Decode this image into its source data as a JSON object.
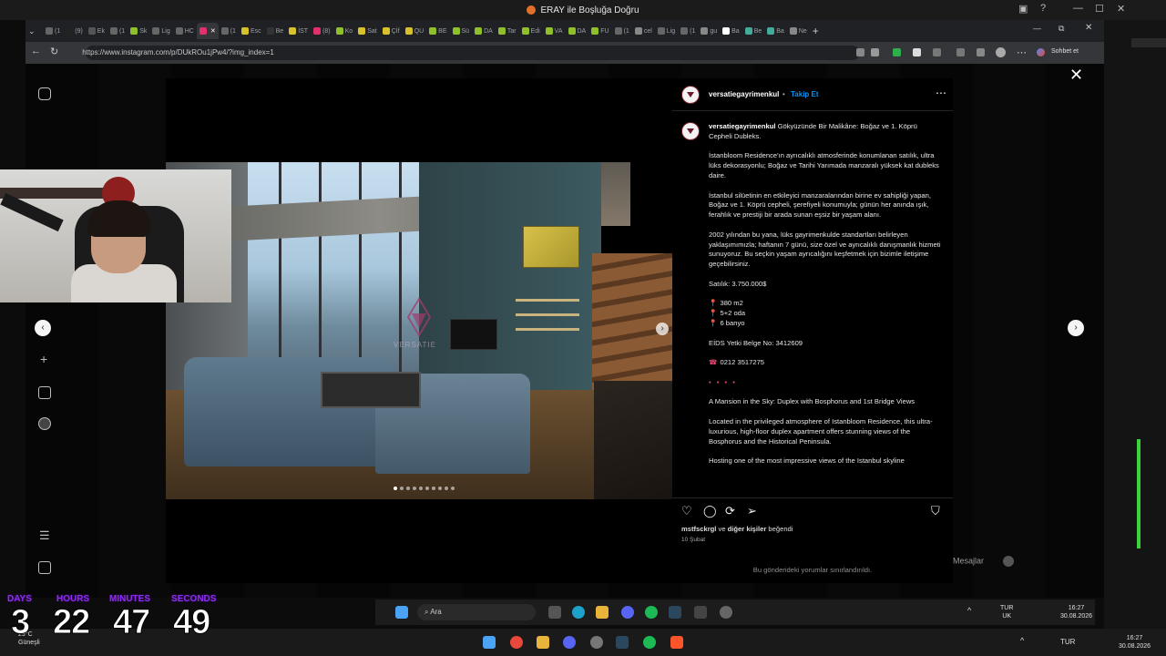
{
  "window": {
    "title": "ERAY ile Boşluğa Doğru"
  },
  "browser": {
    "tabs": [
      {
        "label": "(1",
        "color": "#666"
      },
      {
        "label": "(9)",
        "color": "#222"
      },
      {
        "label": "Ek",
        "color": "#555"
      },
      {
        "label": "(1",
        "color": "#666"
      },
      {
        "label": "Sk",
        "color": "#8fbf2a"
      },
      {
        "label": "Lig",
        "color": "#666"
      },
      {
        "label": "HC",
        "color": "#666"
      },
      {
        "label": "",
        "color": "#e1306c"
      },
      {
        "label": "(1",
        "color": "#666"
      },
      {
        "label": "Esc",
        "color": "#d8c12a"
      },
      {
        "label": "Be",
        "color": "#333"
      },
      {
        "label": "İST",
        "color": "#d8c12a"
      },
      {
        "label": "(8)",
        "color": "#e1306c"
      },
      {
        "label": "Ko",
        "color": "#8fbf2a"
      },
      {
        "label": "Sat",
        "color": "#d8c12a"
      },
      {
        "label": "Çİf",
        "color": "#d8c12a"
      },
      {
        "label": "QU",
        "color": "#d8c12a"
      },
      {
        "label": "BE",
        "color": "#8fbf2a"
      },
      {
        "label": "Sü",
        "color": "#8fbf2a"
      },
      {
        "label": "DA",
        "color": "#8fbf2a"
      },
      {
        "label": "Tar",
        "color": "#8fbf2a"
      },
      {
        "label": "Edi",
        "color": "#8fbf2a"
      },
      {
        "label": "VA",
        "color": "#8fbf2a"
      },
      {
        "label": "DA",
        "color": "#8fbf2a"
      },
      {
        "label": "FU",
        "color": "#8fbf2a"
      },
      {
        "label": "(1",
        "color": "#666"
      },
      {
        "label": "cel",
        "color": "#888"
      },
      {
        "label": "Lig",
        "color": "#666"
      },
      {
        "label": "(1",
        "color": "#666"
      },
      {
        "label": "gu",
        "color": "#888"
      },
      {
        "label": "Ba",
        "color": "#fff"
      },
      {
        "label": "Be",
        "color": "#4a9"
      },
      {
        "label": "Ba",
        "color": "#4a9"
      },
      {
        "label": "Ne",
        "color": "#888"
      }
    ],
    "url": "https://www.instagram.com/p/DUkROu1jPw4/?img_index=1",
    "chat_label": "Sohbet et"
  },
  "post": {
    "username": "versatiegayrimenkul",
    "follow": "Takip Et",
    "caption_title": "Gökyüzünde Bir Malikâne: Boğaz ve 1. Köprü Cepheli Dubleks.",
    "paragraphs": [
      "İstanbloom Residence'ın ayrıcalıklı atmosferinde konumlanan satılık, ultra lüks dekorasyonlu; Boğaz ve Tarihi Yarımada manzaralı yüksek kat dubleks daire.",
      "İstanbul silüetinin en etkileyici manzaralarından birine ev sahipliği yapan, Boğaz ve 1. Köprü cepheli, şerefiyeli konumuyla; günün her anında ışık, ferahlık ve prestiji bir arada sunan eşsiz bir yaşam alanı.",
      "2002 yılından bu yana, lüks gayrimenkulde standartları belirleyen yaklaşımımızla; haftanın 7 günü, size özel ve ayrıcalıklı danışmanlık hizmeti sunuyoruz. Bu seçkin yaşam ayrıcalığını keşfetmek için bizimle iletişime geçebilirsiniz.",
      "Satılık: 3.750.000$"
    ],
    "features": [
      "380 m2",
      "5+2 oda",
      "6 banyo"
    ],
    "license": "EİDS Yetki Belge No: 3412609",
    "phone": "0212 3517275",
    "bullets": "• • • •",
    "en_title": "A Mansion in the Sky: Duplex with Bosphorus and 1st Bridge Views",
    "en_p1": "Located in the privileged atmosphere of Istanbloom Residence, this ultra-luxurious, high-floor duplex apartment offers stunning views of the Bosphorus and the Historical Peninsula.",
    "en_p2": "Hosting one of the most impressive views of the Istanbul skyline",
    "likes_user": "mstfsckrgl",
    "likes_rest": " ve ",
    "likes_others": "diğer kişiler",
    "likes_end": " beğendi",
    "date": "10 Şubat",
    "comments_limited": "Bu gönderideki yorumlar sınırlandırıldı.",
    "watermark": "VERSATIE"
  },
  "messages_label": "Mesajlar",
  "taskbar_inner": {
    "search": "Ara",
    "lang1": "TUR",
    "lang2": "UK",
    "time": "16:27",
    "date": "30.08.2026"
  },
  "taskbar_outer": {
    "lang": "TUR",
    "time": "16:27",
    "date": "30.08.2026"
  },
  "weather": {
    "temp": "29°C",
    "label": "Güneşli"
  },
  "countdown": {
    "labels": [
      "DAYS",
      "HOURS",
      "MINUTES",
      "SECONDS"
    ],
    "values": [
      "3",
      "22",
      "47",
      "49"
    ]
  },
  "icons": {
    "back": "arrow-left-icon",
    "reload": "reload-icon",
    "close": "close-icon",
    "like": "heart-icon",
    "comment": "comment-icon",
    "repost": "repost-icon",
    "share": "send-icon",
    "save": "bookmark-icon",
    "more": "more-icon"
  },
  "colors": {
    "accent": "#0095f6",
    "pin": "#e84b73",
    "countdown_label": "#8d2df0"
  }
}
